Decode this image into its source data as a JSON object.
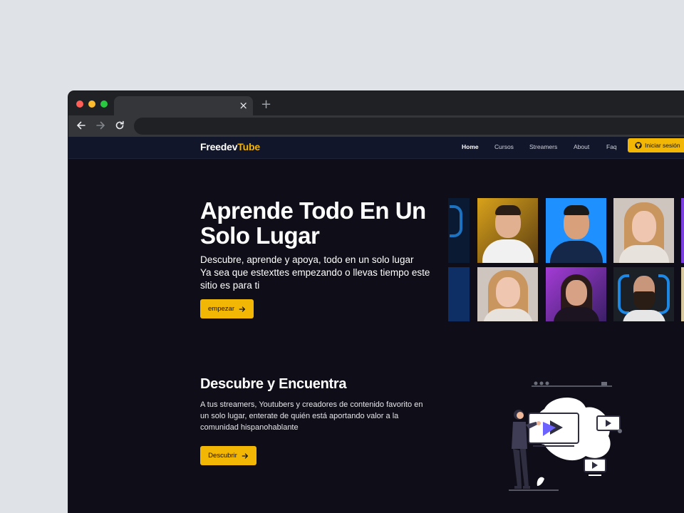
{
  "browser": {
    "tab_title": "",
    "tab_close": "×",
    "new_tab": "+",
    "url": ""
  },
  "nav": {
    "logo_main": "Freedev",
    "logo_accent": "Tube",
    "links": [
      "Home",
      "Cursos",
      "Streamers",
      "About",
      "Faq"
    ],
    "login": "Iniciar sesión"
  },
  "hero": {
    "title": "Aprende Todo En Un Solo Lugar",
    "subtitle_1": "Descubre, aprende y apoya, todo en un solo lugar",
    "subtitle_2": "Ya sea que estexttes empezando o llevas tiempo este sitio es para ti",
    "cta": "empezar"
  },
  "section": {
    "title": "Descubre y Encuentra",
    "text": "A tus streamers, Youtubers y creadores de contenido favorito en un solo lugar, enterate de quién está aportando valor a la comunidad hispanohablante",
    "cta": "Descubrir"
  },
  "colors": {
    "accent": "#f2b705",
    "site_bg": "#0f0d17",
    "nav_bg": "#12162a",
    "page_bg": "#dfe2e7"
  }
}
